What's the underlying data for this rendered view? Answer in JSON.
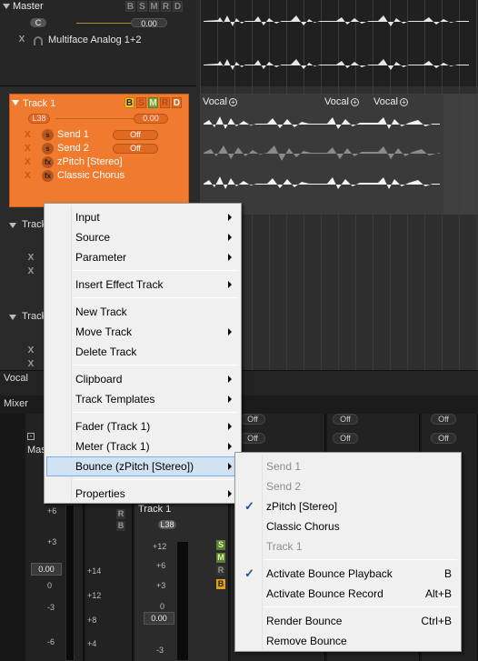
{
  "master": {
    "title": "Master",
    "buttons": [
      "B",
      "S",
      "M",
      "R",
      "D"
    ],
    "pan_label": "C",
    "volume": "0.00",
    "output_x": "X",
    "output_name": "Multiface Analog 1+2"
  },
  "track1": {
    "title": "Track 1",
    "buttons": [
      "B",
      "S",
      "M",
      "R",
      "D"
    ],
    "pan_value": "L38",
    "volume": "0.00",
    "rows": [
      {
        "x": "X",
        "icon": "s",
        "label": "Send 1",
        "state": "Off"
      },
      {
        "x": "X",
        "icon": "s",
        "label": "Send 2",
        "state": "Off"
      },
      {
        "x": "X",
        "icon": "fx",
        "label": "zPitch [Stereo]",
        "state": ""
      },
      {
        "x": "X",
        "icon": "fx",
        "label": "Classic Chorus",
        "state": ""
      }
    ]
  },
  "other_tracks": {
    "track2_label": "Track",
    "track3_label": "Track",
    "x_label": "X"
  },
  "arrange": {
    "clips": [
      "Vocal",
      "Vocal",
      "Vocal"
    ]
  },
  "vocal_strip": {
    "label": "Vocal"
  },
  "mixer": {
    "label": "Mixer",
    "master_strip_label": "Mas",
    "track_label": "Track 1",
    "pan": "L38",
    "off_label": "Off",
    "fader_value": "0.00",
    "fader_value2": "0.00",
    "scale_left": [
      "+6",
      "+3",
      "0",
      "-3",
      "-6"
    ],
    "scale_mid": [
      "+14",
      "+12",
      "+8",
      "+4"
    ],
    "scale_track": [
      "+12",
      "+6",
      "+3",
      "0",
      "-3"
    ],
    "rb": [
      "R",
      "B"
    ],
    "smrb": [
      "S",
      "M",
      "R",
      "B"
    ]
  },
  "context_menu": {
    "items": [
      {
        "label": "Input",
        "submenu": true
      },
      {
        "label": "Source",
        "submenu": true
      },
      {
        "label": "Parameter",
        "submenu": true
      },
      {
        "label": "Insert Effect Track",
        "submenu": true
      },
      {
        "label": "New Track",
        "submenu": false
      },
      {
        "label": "Move Track",
        "submenu": true
      },
      {
        "label": "Delete Track",
        "submenu": false
      },
      {
        "label": "Clipboard",
        "submenu": true
      },
      {
        "label": "Track Templates",
        "submenu": true
      },
      {
        "label": "Fader (Track 1)",
        "submenu": true
      },
      {
        "label": "Meter (Track 1)",
        "submenu": true
      },
      {
        "label": "Bounce (zPitch [Stereo])",
        "submenu": true
      },
      {
        "label": "Properties",
        "submenu": true
      }
    ]
  },
  "bounce_submenu": {
    "items": [
      {
        "label": "Send 1",
        "disabled": true
      },
      {
        "label": "Send 2",
        "disabled": true
      },
      {
        "label": "zPitch [Stereo]",
        "checked": true
      },
      {
        "label": "Classic Chorus"
      },
      {
        "label": "Track 1",
        "disabled": true
      },
      {
        "label": "Activate Bounce Playback",
        "checked": true,
        "shortcut": "B"
      },
      {
        "label": "Activate Bounce Record",
        "shortcut": "Alt+B"
      },
      {
        "label": "Render Bounce",
        "shortcut": "Ctrl+B"
      },
      {
        "label": "Remove Bounce"
      }
    ],
    "check_glyph": "✓"
  },
  "colors": {
    "track_selected": "#f07a2e",
    "menu_bg": "#f0f0f0",
    "menu_highlight": "#d1e2f2"
  }
}
